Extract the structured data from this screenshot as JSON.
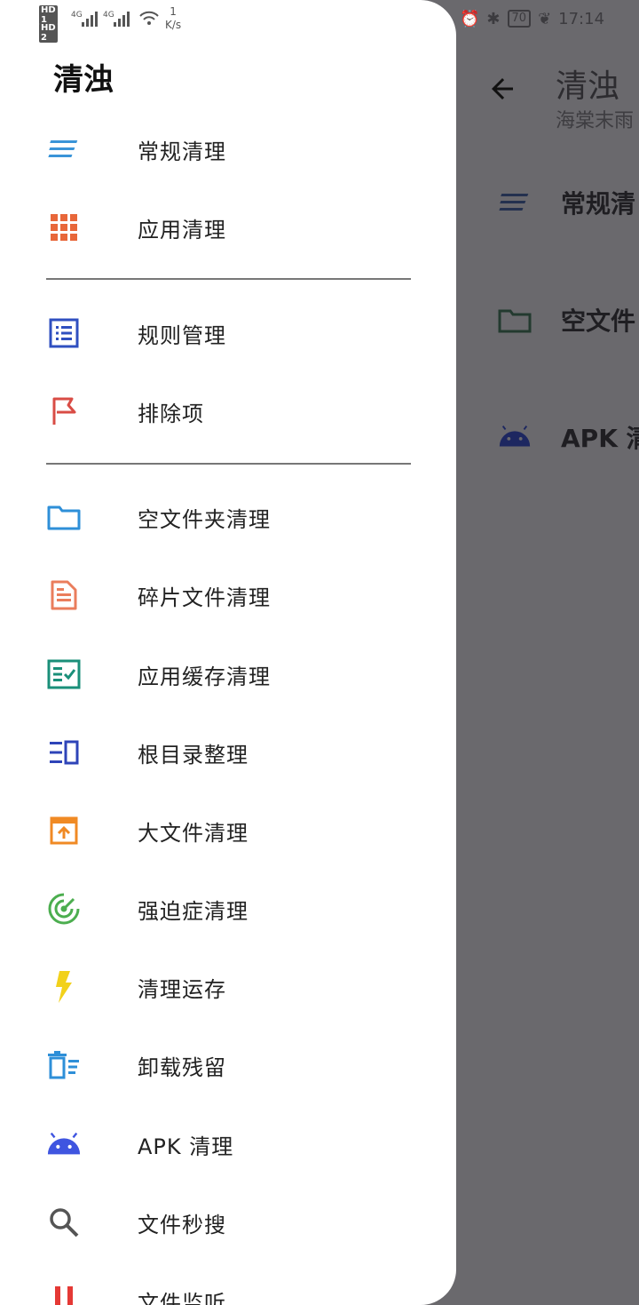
{
  "status_bar": {
    "left": {
      "hd1": "HD 1",
      "hd2": "HD 2",
      "net1": "4G",
      "net2": "4G",
      "speed_value": "1",
      "speed_unit": "K/s"
    },
    "right": {
      "battery": "70",
      "time": "17:14"
    }
  },
  "background_app": {
    "title": "清浊",
    "subtitle": "海棠末雨",
    "rows": [
      {
        "label": "常规清",
        "icon": "lines-icon",
        "color": "#24314f"
      },
      {
        "label": "空文件",
        "icon": "folder-icon",
        "color": "#233a2f"
      },
      {
        "label": "APK 清",
        "icon": "android-icon",
        "color": "#1d2760"
      }
    ]
  },
  "drawer": {
    "title": "清浊",
    "sections": [
      [
        {
          "label": "常规清理",
          "icon": "lines-icon",
          "color": "#3a94d8"
        },
        {
          "label": "应用清理",
          "icon": "apps-grid-icon",
          "color": "#e8673a"
        }
      ],
      [
        {
          "label": "规则管理",
          "icon": "list-icon",
          "color": "#2f4fc0"
        },
        {
          "label": "排除项",
          "icon": "flag-icon",
          "color": "#d94c45"
        }
      ],
      [
        {
          "label": "空文件夹清理",
          "icon": "folder-icon",
          "color": "#2e8fd8"
        },
        {
          "label": "碎片文件清理",
          "icon": "document-icon",
          "color": "#ea7d5c"
        },
        {
          "label": "应用缓存清理",
          "icon": "checklist-icon",
          "color": "#1a8f79"
        },
        {
          "label": "根目录整理",
          "icon": "root-icon",
          "color": "#2e44b8"
        },
        {
          "label": "大文件清理",
          "icon": "archive-icon",
          "color": "#f08a24"
        },
        {
          "label": "强迫症清理",
          "icon": "radar-icon",
          "color": "#4cae4f"
        },
        {
          "label": "清理运存",
          "icon": "lightning-icon",
          "color": "#f2d11b"
        },
        {
          "label": "卸载残留",
          "icon": "delete-list-icon",
          "color": "#2e8fd8"
        },
        {
          "label": "APK 清理",
          "icon": "android-icon",
          "color": "#3f55e0"
        },
        {
          "label": "文件秒搜",
          "icon": "search-icon",
          "color": "#555555"
        },
        {
          "label": "文件监听",
          "icon": "pause-icon",
          "color": "#e53935"
        }
      ]
    ]
  }
}
